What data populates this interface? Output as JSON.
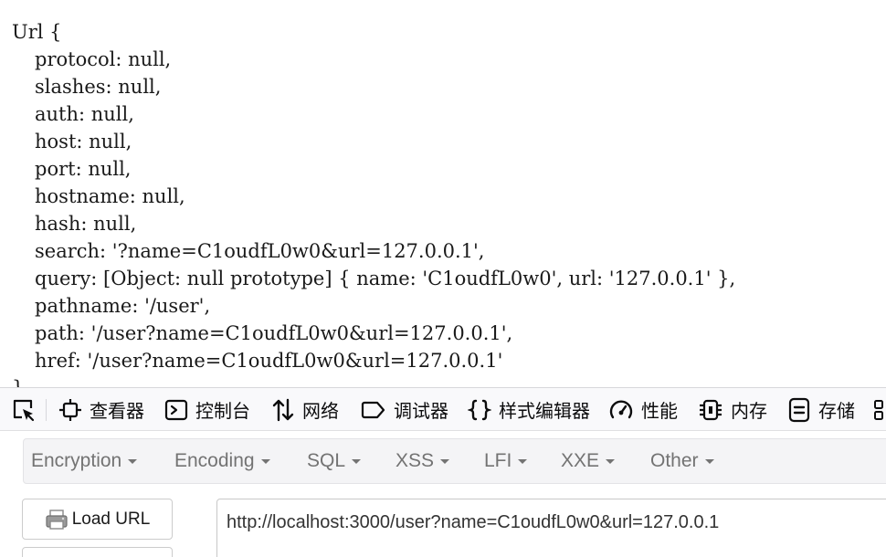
{
  "output": {
    "lines": [
      "Url {",
      "protocol: null,",
      "slashes: null,",
      "auth: null,",
      "host: null,",
      "port: null,",
      "hostname: null,",
      "hash: null,",
      "search: '?name=C1oudfL0w0&url=127.0.0.1',",
      "query: [Object: null prototype] { name: 'C1oudfL0w0', url: '127.0.0.1' },",
      "pathname: '/user',",
      "path: '/user?name=C1oudfL0w0&url=127.0.0.1',",
      "href: '/user?name=C1oudfL0w0&url=127.0.0.1'",
      "}"
    ]
  },
  "devtools": {
    "tabs": [
      {
        "label": "",
        "icon": "element-picker-icon"
      },
      {
        "label": "查看器",
        "icon": "inspector-icon"
      },
      {
        "label": "控制台",
        "icon": "console-icon"
      },
      {
        "label": "网络",
        "icon": "network-icon"
      },
      {
        "label": "调试器",
        "icon": "debugger-icon"
      },
      {
        "label": "样式编辑器",
        "icon": "style-editor-icon"
      },
      {
        "label": "性能",
        "icon": "performance-icon"
      },
      {
        "label": "内存",
        "icon": "memory-icon"
      },
      {
        "label": "存储",
        "icon": "storage-icon"
      }
    ]
  },
  "hackbar": {
    "menu": [
      "Encryption",
      "Encoding",
      "SQL",
      "XSS",
      "LFI",
      "XXE",
      "Other"
    ],
    "load_url_label": "Load URL",
    "url_value": "http://localhost:3000/user?name=C1oudfL0w0&url=127.0.0.1"
  },
  "colors": {
    "toolbar_bg": "#f9f9fb",
    "menu_bg": "#f4f4f6",
    "menu_text": "#737373",
    "output_text": "#1a1a1a"
  }
}
